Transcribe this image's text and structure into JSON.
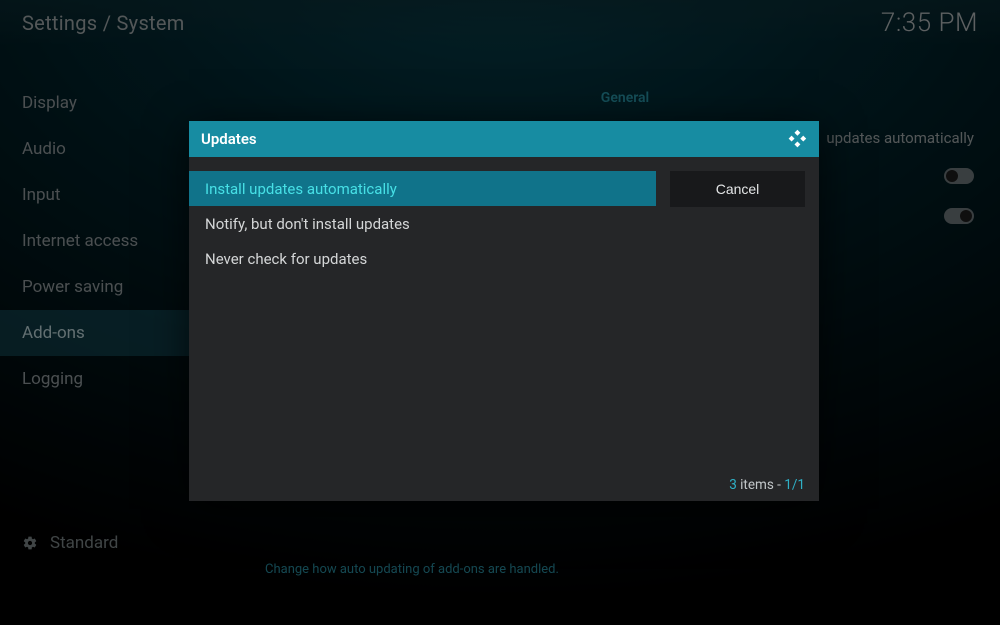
{
  "colors": {
    "accent": "#178ca2",
    "highlight": "#10738a",
    "highlight_text": "#47e0e6"
  },
  "header": {
    "breadcrumb": "Settings / System",
    "clock": "7:35 PM"
  },
  "sidebar": {
    "items": [
      {
        "label": "Display",
        "selected": false
      },
      {
        "label": "Audio",
        "selected": false
      },
      {
        "label": "Input",
        "selected": false
      },
      {
        "label": "Internet access",
        "selected": false
      },
      {
        "label": "Power saving",
        "selected": false
      },
      {
        "label": "Add-ons",
        "selected": true
      },
      {
        "label": "Logging",
        "selected": false
      }
    ],
    "level_label": "Standard",
    "level_icon": "gear-icon"
  },
  "background_page": {
    "section_header": "General",
    "visible_setting_label_fragment": "updates automatically",
    "row1_toggle_on": false,
    "row2_toggle_on": true,
    "helper_text": "Change how auto updating of add-ons are handled."
  },
  "dialog": {
    "title": "Updates",
    "title_icon": "kodi-logo-icon",
    "options": [
      {
        "label": "Install updates automatically",
        "highlighted": true
      },
      {
        "label": "Notify, but don't install updates",
        "highlighted": false
      },
      {
        "label": "Never check for updates",
        "highlighted": false
      }
    ],
    "cancel_label": "Cancel",
    "footer": {
      "count": "3",
      "items_word": " items - ",
      "page": "1/1"
    }
  }
}
